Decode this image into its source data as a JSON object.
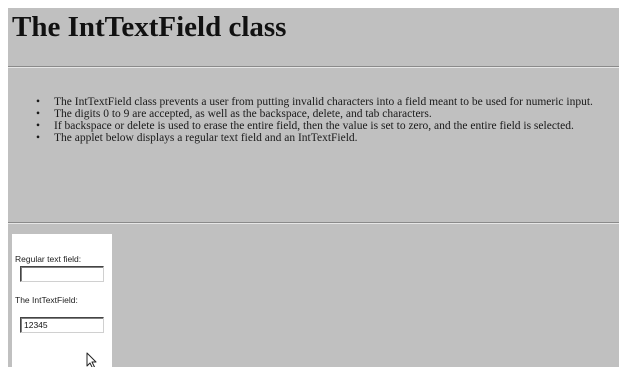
{
  "page": {
    "title": "The IntTextField class"
  },
  "bullets": [
    "The IntTextField class prevents a user from putting invalid characters into a field meant to be used for numeric input.",
    "The digits 0 to 9 are accepted, as well as the backspace, delete, and tab characters.",
    "If backspace or delete is used to erase the entire field, then the value is set to zero, and the entire field is selected.",
    "The applet below displays a regular text field and an IntTextField."
  ],
  "bullet_glyph": "•",
  "applet": {
    "regular_label": "Regular text field:",
    "regular_value": "",
    "int_label": "The IntTextField:",
    "int_value": "12345",
    "cursor_icon": "mouse-pointer-icon"
  },
  "colors": {
    "page_background": "#c0c0c0",
    "applet_background": "#ffffff"
  }
}
